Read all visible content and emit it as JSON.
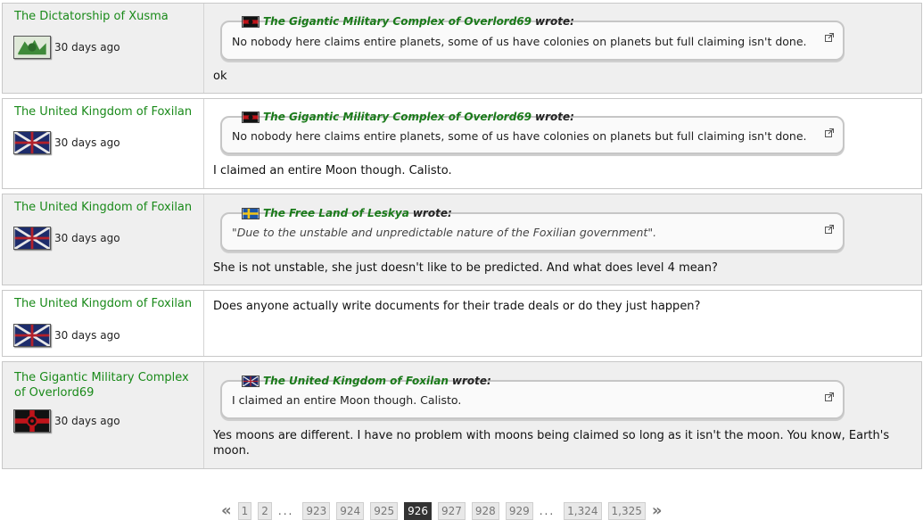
{
  "posts": [
    {
      "author": "The Dictatorship of Xusma",
      "time": "30 days ago",
      "quote": {
        "author": "The Gigantic Military Complex of Overlord69",
        "wrote": "wrote:",
        "text": "No nobody here claims entire planets, some of us have colonies on planets but full claiming isn't done."
      },
      "message": "ok"
    },
    {
      "author": "The United Kingdom of Foxilan",
      "time": "30 days ago",
      "quote": {
        "author": "The Gigantic Military Complex of Overlord69",
        "wrote": "wrote:",
        "text": "No nobody here claims entire planets, some of us have colonies on planets but full claiming isn't done."
      },
      "message": "I claimed an entire Moon though. Calisto."
    },
    {
      "author": "The United Kingdom of Foxilan",
      "time": "30 days ago",
      "quote": {
        "author": "The Free Land of Leskya",
        "wrote": "wrote:",
        "text": "\"Due to the unstable and unpredictable nature of the Foxilian government\"."
      },
      "message": "She is not unstable, she just doesn't like to be predicted. And what does level 4 mean?"
    },
    {
      "author": "The United Kingdom of Foxilan",
      "time": "30 days ago",
      "message": "Does anyone actually write documents for their trade deals or do they just happen?"
    },
    {
      "author_line1": "The Gigantic Military Complex",
      "author_line2": "of Overlord69",
      "time": "30 days ago",
      "quote": {
        "author": "The United Kingdom of Foxilan",
        "wrote": "wrote:",
        "text": "I claimed an entire Moon though. Calisto."
      },
      "message_line1": "Yes moons are different. I have no problem with moons being claimed so long as it isn't the moon. You know, Earth's",
      "message_line2": "moon."
    }
  ],
  "pager": {
    "first": "«",
    "last": "»",
    "ellipsis": "...",
    "pages": [
      "1",
      "2",
      "923",
      "924",
      "925",
      "926",
      "927",
      "928",
      "929",
      "1,324",
      "1,325"
    ],
    "current": "926"
  },
  "colors": {
    "link_green": "#1a8a1a",
    "row_alt": "#efefef",
    "current_page": "#333333"
  }
}
